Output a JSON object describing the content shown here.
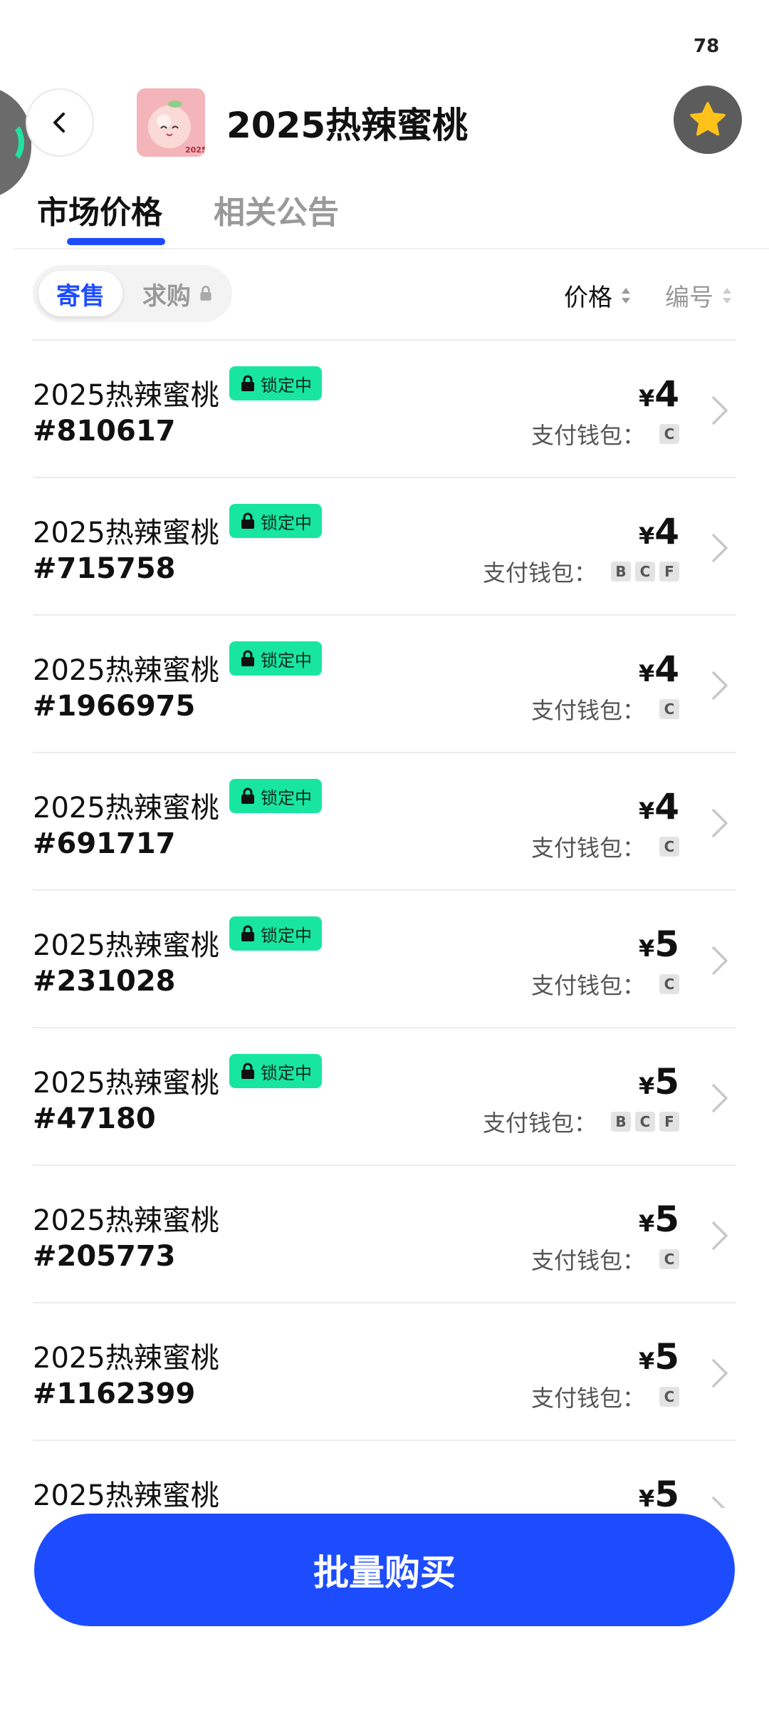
{
  "status": {
    "number": "78"
  },
  "header": {
    "title": "2025热辣蜜桃",
    "avatar_text": "2025"
  },
  "tabs": [
    {
      "label": "市场价格",
      "active": true
    },
    {
      "label": "相关公告",
      "active": false
    }
  ],
  "segment": {
    "sell_label": "寄售",
    "buy_label": "求购"
  },
  "sort": {
    "price_label": "价格",
    "number_label": "编号"
  },
  "currency_symbol": "¥",
  "wallet_label": "支付钱包：",
  "listings": [
    {
      "name": "2025热辣蜜桃",
      "serial": "#810617",
      "locked": true,
      "lock_label": "锁定中",
      "price": "4",
      "wallets": [
        "C"
      ]
    },
    {
      "name": "2025热辣蜜桃",
      "serial": "#715758",
      "locked": true,
      "lock_label": "锁定中",
      "price": "4",
      "wallets": [
        "B",
        "C",
        "F"
      ]
    },
    {
      "name": "2025热辣蜜桃",
      "serial": "#1966975",
      "locked": true,
      "lock_label": "锁定中",
      "price": "4",
      "wallets": [
        "C"
      ]
    },
    {
      "name": "2025热辣蜜桃",
      "serial": "#691717",
      "locked": true,
      "lock_label": "锁定中",
      "price": "4",
      "wallets": [
        "C"
      ]
    },
    {
      "name": "2025热辣蜜桃",
      "serial": "#231028",
      "locked": true,
      "lock_label": "锁定中",
      "price": "5",
      "wallets": [
        "C"
      ]
    },
    {
      "name": "2025热辣蜜桃",
      "serial": "#47180",
      "locked": true,
      "lock_label": "锁定中",
      "price": "5",
      "wallets": [
        "B",
        "C",
        "F"
      ]
    },
    {
      "name": "2025热辣蜜桃",
      "serial": "#205773",
      "locked": false,
      "lock_label": "",
      "price": "5",
      "wallets": [
        "C"
      ]
    },
    {
      "name": "2025热辣蜜桃",
      "serial": "#1162399",
      "locked": false,
      "lock_label": "",
      "price": "5",
      "wallets": [
        "C"
      ]
    },
    {
      "name": "2025热辣蜜桃",
      "serial": "",
      "locked": false,
      "lock_label": "",
      "price": "5",
      "wallets": []
    }
  ],
  "cta": {
    "label": "批量购买"
  },
  "colors": {
    "accent": "#1d4cff",
    "badge": "#18e6a0",
    "fav_star": "#ffc21a"
  }
}
